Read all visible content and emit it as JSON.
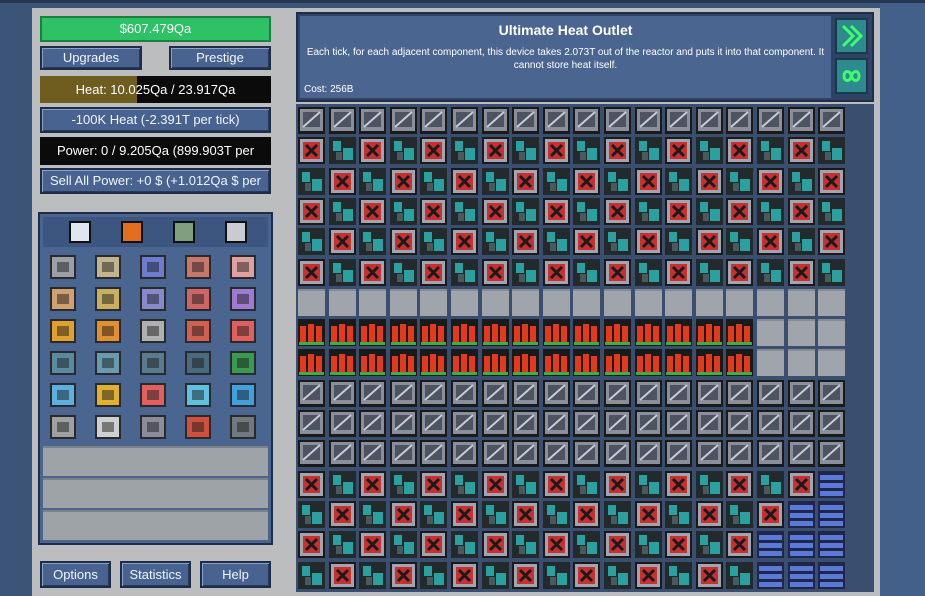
{
  "money": "$607.479Qa",
  "buttons": {
    "upgrades": "Upgrades",
    "prestige": "Prestige",
    "vent_heat": "-100K Heat (-2.391T per tick)",
    "sell_power": "Sell All Power: +0 $ (+1.012Qa $ per",
    "options": "Options",
    "statistics": "Statistics",
    "help": "Help"
  },
  "heat": {
    "text": "Heat: 10.025Qa / 23.917Qa",
    "fraction": 0.419
  },
  "power": {
    "text": "Power: 0 / 9.205Qa (899.903T per"
  },
  "info": {
    "title": "Ultimate Heat Outlet",
    "description": "Each tick, for each adjacent component, this device takes 2.073T out of the reactor and puts it into that component. It cannot store heat itself.",
    "cost": "Cost: 256B"
  },
  "part_tabs": [
    "cells-tab-icon",
    "fire-tab-icon",
    "vent-tab-icon",
    "exchanger-tab-icon"
  ],
  "part_rows": [
    [
      {
        "icon": "vent-icon",
        "c": "#9aa0a6"
      },
      {
        "icon": "vent-icon",
        "c": "#c2b48f"
      },
      {
        "icon": "vent-icon",
        "c": "#6d7ccf"
      },
      {
        "icon": "vent-icon",
        "c": "#c9776b"
      },
      {
        "icon": "vent-icon",
        "c": "#e0a0a0"
      }
    ],
    [
      {
        "icon": "exchanger-icon",
        "c": "#d0a070"
      },
      {
        "icon": "exchanger-icon",
        "c": "#c8b060"
      },
      {
        "icon": "exchanger-icon",
        "c": "#8888cc"
      },
      {
        "icon": "exchanger-icon",
        "c": "#cc6666"
      },
      {
        "icon": "exchanger-icon",
        "c": "#a07ad0"
      }
    ],
    [
      {
        "icon": "heat-inlet-icon",
        "c": "#e0a030"
      },
      {
        "icon": "heat-inlet-icon",
        "c": "#e09030"
      },
      {
        "icon": "heat-inlet-icon",
        "c": "#b0b0b0"
      },
      {
        "icon": "heat-inlet-icon",
        "c": "#d06050"
      },
      {
        "icon": "heat-inlet-icon",
        "c": "#e06060"
      }
    ],
    [
      {
        "icon": "heat-outlet-icon",
        "c": "#5a8aa0"
      },
      {
        "icon": "heat-outlet-icon",
        "c": "#6a9ab0"
      },
      {
        "icon": "heat-outlet-icon",
        "c": "#5a7a90"
      },
      {
        "icon": "heat-outlet-icon",
        "c": "#4a6a80"
      },
      {
        "icon": "heat-outlet-icon",
        "c": "#3a9a50"
      }
    ],
    [
      {
        "icon": "capacitor-icon",
        "c": "#5ab0e0"
      },
      {
        "icon": "capacitor-icon",
        "c": "#e0b030"
      },
      {
        "icon": "capacitor-icon",
        "c": "#e06060"
      },
      {
        "icon": "capacitor-icon",
        "c": "#60c0e0"
      },
      {
        "icon": "capacitor-icon",
        "c": "#40a0e0"
      }
    ],
    [
      {
        "icon": "plating-icon",
        "c": "#a0a0a0"
      },
      {
        "icon": "plating-icon",
        "c": "#d0d0d0"
      },
      {
        "icon": "plating-icon",
        "c": "#8c8c9c"
      },
      {
        "icon": "plating-icon",
        "c": "#d05040"
      },
      {
        "icon": "plating-icon",
        "c": "#707880"
      }
    ]
  ],
  "grid_rows": [
    "pppppppppppppppppp",
    "hvhvhvhvhvhvhvhvhv",
    "vhvhvhvhvhvhvhvhvh",
    "hvhvhvhvhvhvhvhvhv",
    "vhvhvhvhvhvhvhvhvh",
    "hvhvhvhvhvhvhvhvhv",
    "eeeeeeeeeeeeeeeeee",
    "ccccccccccccccceee",
    "ccccccccccccccceee",
    "pppppppppppppppppp",
    "pppppppppppppppppp",
    "pppppppppppppppppp",
    "hvhvhvhvhvhvhvhvhr",
    "vhvhvhvhvhvhvhvhrr",
    "hvhvhvhvhvhvhvhrrr",
    "vhvhvhvhvhvhvhvrrr"
  ]
}
